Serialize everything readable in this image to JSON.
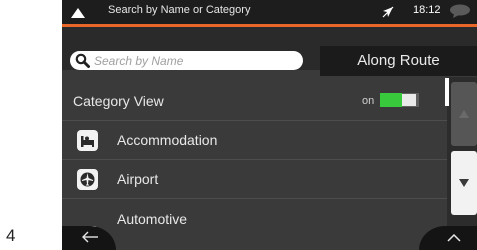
{
  "page_number": "4",
  "status": {
    "title": "Search by Name or Category",
    "time": "18:12"
  },
  "search": {
    "placeholder": "Search by Name",
    "value": ""
  },
  "along_route_label": "Along Route",
  "category_view": {
    "label": "Category View",
    "toggle_text": "on",
    "enabled": true
  },
  "categories": [
    {
      "label": "Accommodation",
      "icon": "bed-icon"
    },
    {
      "label": "Airport",
      "icon": "airplane-icon"
    },
    {
      "label": "Automotive",
      "icon": "car-icon"
    }
  ],
  "colors": {
    "accent": "#e8662a",
    "toggle_on": "#38c93d"
  }
}
